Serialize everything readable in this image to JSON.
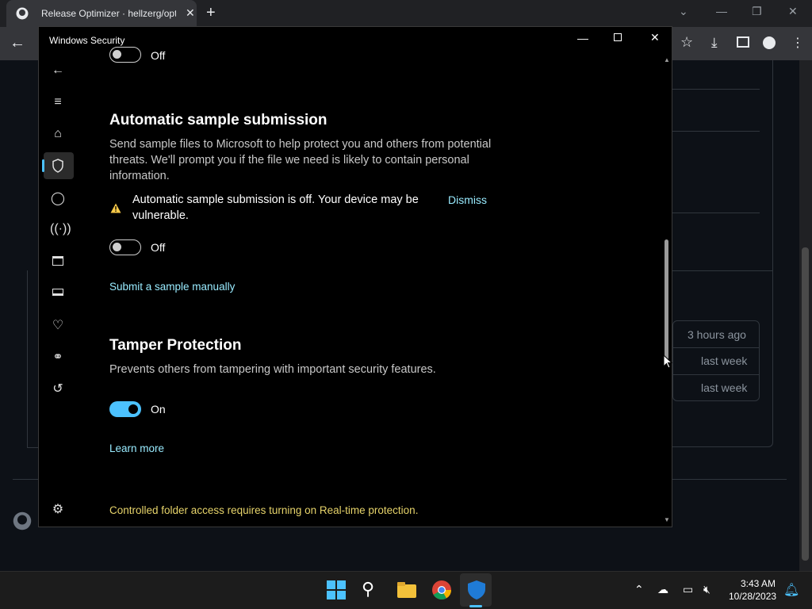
{
  "browser": {
    "tab_title": "Release Optimizer · hellzerg/opt",
    "tab_close": "✕",
    "new_tab": "+"
  },
  "github_page": {
    "list_times": [
      "3 hours ago",
      "last week",
      "last week"
    ]
  },
  "windows_security": {
    "window_title": "Windows Security",
    "top_toggle_label": "Off",
    "sample_submission": {
      "heading": "Automatic sample submission",
      "description": "Send sample files to Microsoft to help protect you and others from potential threats. We'll prompt you if the file we need is likely to contain personal information.",
      "warning": "Automatic sample submission is off. Your device may be vulnerable.",
      "dismiss": "Dismiss",
      "toggle_label": "Off",
      "link": "Submit a sample manually"
    },
    "tamper_protection": {
      "heading": "Tamper Protection",
      "description": "Prevents others from tampering with important security features.",
      "toggle_label": "On",
      "link": "Learn more"
    },
    "controlled_folder_notice": "Controlled folder access requires turning on Real-time protection.",
    "nav_icons": [
      "back-icon",
      "menu-icon",
      "home-icon",
      "shield-icon",
      "person-icon",
      "wifi-icon",
      "app-browser-icon",
      "laptop-icon",
      "heart-icon",
      "family-icon",
      "history-icon",
      "settings-icon"
    ]
  },
  "taskbar": {
    "time": "3:43 AM",
    "date": "10/28/2023"
  },
  "colors": {
    "accent": "#4cc2ff",
    "link": "#99ebff",
    "notice": "#e6d36a",
    "warning": "#f7c948"
  }
}
